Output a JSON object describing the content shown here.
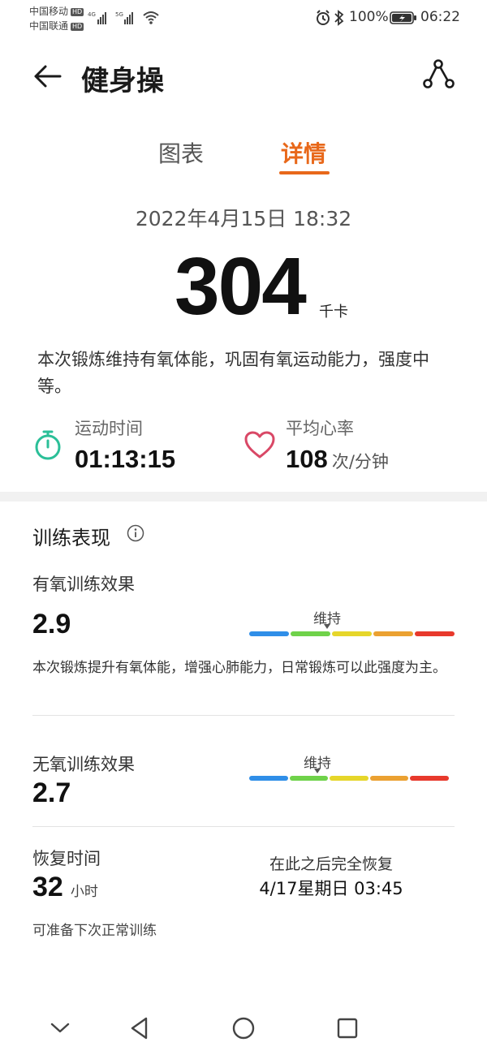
{
  "status_bar": {
    "carrier1": "中国移动",
    "carrier2": "中国联通",
    "hd_badge": "HD",
    "net1": "4G",
    "net2": "5G",
    "battery": "100%",
    "time": "06:22"
  },
  "header": {
    "title": "健身操",
    "back_icon": "back-arrow-icon",
    "share_icon": "route-icon"
  },
  "tabs": [
    {
      "label": "图表",
      "active": false
    },
    {
      "label": "详情",
      "active": true
    }
  ],
  "summary": {
    "datetime": "2022年4月15日 18:32",
    "calories": "304",
    "calories_unit": "千卡",
    "description": "本次锻炼维持有氧体能，巩固有氧运动能力，强度中等。"
  },
  "stats": {
    "duration_label": "运动时间",
    "duration_value": "01:13:15",
    "hr_label": "平均心率",
    "hr_value": "108",
    "hr_unit": "次/分钟"
  },
  "training": {
    "section_title": "训练表现",
    "aerobic": {
      "label": "有氧训练效果",
      "value": "2.9",
      "gauge_label": "维持",
      "description": "本次锻炼提升有氧体能，增强心肺能力，日常锻炼可以此强度为主。"
    },
    "anaerobic": {
      "label": "无氧训练效果",
      "value": "2.7",
      "gauge_label": "维持"
    },
    "recovery": {
      "label": "恢复时间",
      "value": "32",
      "unit": "小时",
      "right_label": "在此之后完全恢复",
      "right_value": "4/17星期日 03:45",
      "note": "可准备下次正常训练"
    }
  },
  "colors": {
    "accent": "#e8681a",
    "gauge": [
      "#2f8ee8",
      "#6fd24a",
      "#e6d62a",
      "#eba131",
      "#e8392c"
    ],
    "timer_icon": "#2bbf98",
    "heart_icon": "#d94866"
  }
}
